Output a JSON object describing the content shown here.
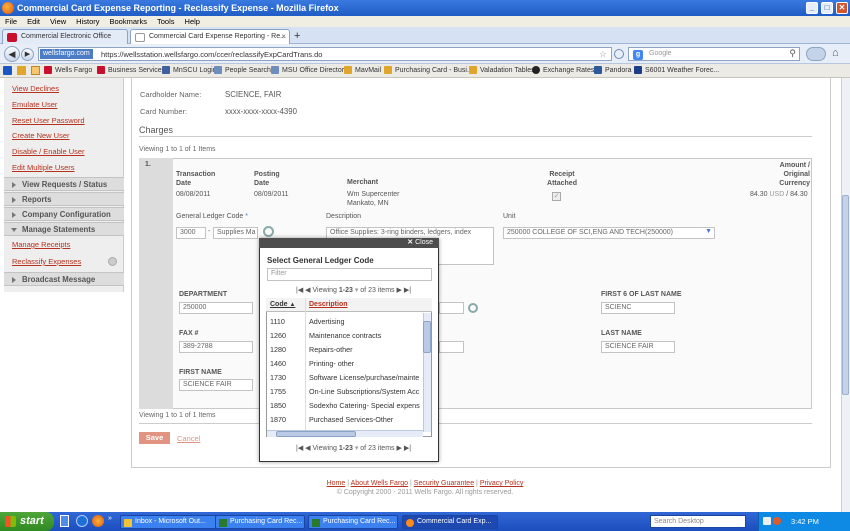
{
  "window": {
    "title": "Commercial Card Expense Reporting - Reclassify Expense - Mozilla Firefox"
  },
  "menu": [
    "File",
    "Edit",
    "View",
    "History",
    "Bookmarks",
    "Tools",
    "Help"
  ],
  "tabs": [
    {
      "label": "Commercial Electronic Office"
    },
    {
      "label": "Commercial Card Expense Reporting - Re..."
    }
  ],
  "nav": {
    "site_badge": "wellsfargo.com",
    "url": "https://wellsstation.wellsfargo.com/ccer/reclassifyExpCardTrans.do",
    "search_placeholder": "Google"
  },
  "bookmarks": [
    "Wells Fargo",
    "Business Services",
    "MnSCU Login",
    "People Search",
    "MSU Office Directory",
    "MavMail",
    "Purchasing Card - Busi...",
    "Valadation Tables",
    "Exchange Rates",
    "Pandora",
    "S6001 Weather Forec..."
  ],
  "sidebar": {
    "links_top": [
      "View Declines",
      "Emulate User",
      "Reset User Password",
      "Create New User",
      "Disable / Enable User",
      "Edit Multiple Users"
    ],
    "sections": [
      "View Requests / Status",
      "Reports",
      "Company Configuration",
      "Manage Statements"
    ],
    "manage_links": [
      "Manage Receipts",
      "Reclassify Expenses"
    ],
    "broadcast": "Broadcast Message"
  },
  "cardholder": {
    "name_label": "Cardholder Name:",
    "name": "SCIENCE, FAIR",
    "number_label": "Card Number:",
    "number": "xxxx-xxxx-xxxx-4390"
  },
  "charges": {
    "title": "Charges",
    "viewing": "Viewing 1 to 1 of 1 Items",
    "item_no": "1.",
    "headers": {
      "trans": "Transaction Date",
      "post": "Posting Date",
      "merchant": "Merchant",
      "receipt": "Receipt Attached",
      "amount": "Amount / Original Currency"
    },
    "row": {
      "trans_date": "08/08/2011",
      "post_date": "08/09/2011",
      "merchant_line1": "Wm Supercenter",
      "merchant_line2": "Mankato, MN",
      "amount": "84.30",
      "currency": "USD",
      "orig": "84.30"
    },
    "gl_label": "General Ledger Code",
    "gl_required": "*",
    "gl_code": "3000",
    "gl_sep": "-",
    "gl_desc": "Supplies Ma",
    "desc_label": "Description",
    "desc_value": "Office Supplies: 3-ring binders, ledgers, index",
    "unit_label": "Unit",
    "unit_value": "250000 COLLEGE OF SCI,ENG AND TECH(250000)",
    "department_label": "DEPARTMENT",
    "department": "250000",
    "first6_label": "FIRST 6 OF LAST NAME",
    "first6": "SCIENC",
    "fax_label": "FAX #",
    "fax": "389-2788",
    "lastname_label": "LAST NAME",
    "lastname": "SCIENCE FAIR",
    "firstname_label": "FIRST NAME",
    "firstname": "SCIENCE FAIR",
    "viewing_bottom": "Viewing 1 to 1 of 1 Items"
  },
  "actions": {
    "save": "Save",
    "cancel": "Cancel"
  },
  "modal": {
    "close": "Close",
    "title": "Select General Ledger Code",
    "filter_placeholder": "Filter",
    "pager": {
      "viewing": "Viewing",
      "range": "1-23",
      "of": "of 23 items"
    },
    "col_code": "Code",
    "col_desc": "Description",
    "rows": [
      {
        "code": "1110",
        "desc": "Advertising"
      },
      {
        "code": "1260",
        "desc": "Maintenance contracts"
      },
      {
        "code": "1280",
        "desc": "Repairs-other"
      },
      {
        "code": "1460",
        "desc": "Printing- other"
      },
      {
        "code": "1730",
        "desc": "Software License/purchase/mainte"
      },
      {
        "code": "1755",
        "desc": "On-Line Subscriptions/System Acc"
      },
      {
        "code": "1850",
        "desc": "Sodexho Catering- Special expens"
      },
      {
        "code": "1870",
        "desc": "Purchased Services-Other"
      }
    ]
  },
  "footer": {
    "links": [
      "Home",
      "About Wells Fargo",
      "Security Guarantee",
      "Privacy Policy"
    ],
    "copyright": "© Copyright 2000 - 2011 Wells Fargo. All rights reserved."
  },
  "taskbar": {
    "start": "start",
    "tasks": [
      "Inbox - Microsoft Out...",
      "Purchasing Card Rec...",
      "Purchasing Card Rec...",
      "Commercial Card Exp..."
    ],
    "search_placeholder": "Search Desktop",
    "clock": "3:42 PM"
  },
  "colors": {
    "brand_red": "#b7321e",
    "xp_blue": "#245edb"
  }
}
